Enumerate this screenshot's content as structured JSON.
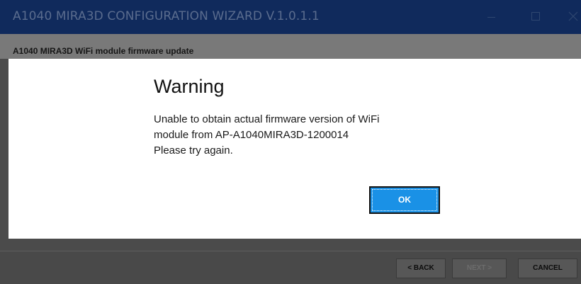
{
  "window": {
    "title": "A1040 MIRA3D CONFIGURATION WIZARD V.1.0.1.1"
  },
  "subheader": {
    "label": "A1040 MIRA3D WiFi module firmware update"
  },
  "dialog": {
    "heading": "Warning",
    "message_lines": [
      "Unable to obtain actual firmware version of WiFi",
      "module from AP-A1040MIRA3D-1200014",
      "Please try again."
    ],
    "ok_label": "OK"
  },
  "footer": {
    "back_label": "< BACK",
    "next_label": "NEXT >",
    "cancel_label": "CANCEL"
  },
  "colors": {
    "titlebar": "#102a5c",
    "ok_button": "#1a91e6"
  }
}
